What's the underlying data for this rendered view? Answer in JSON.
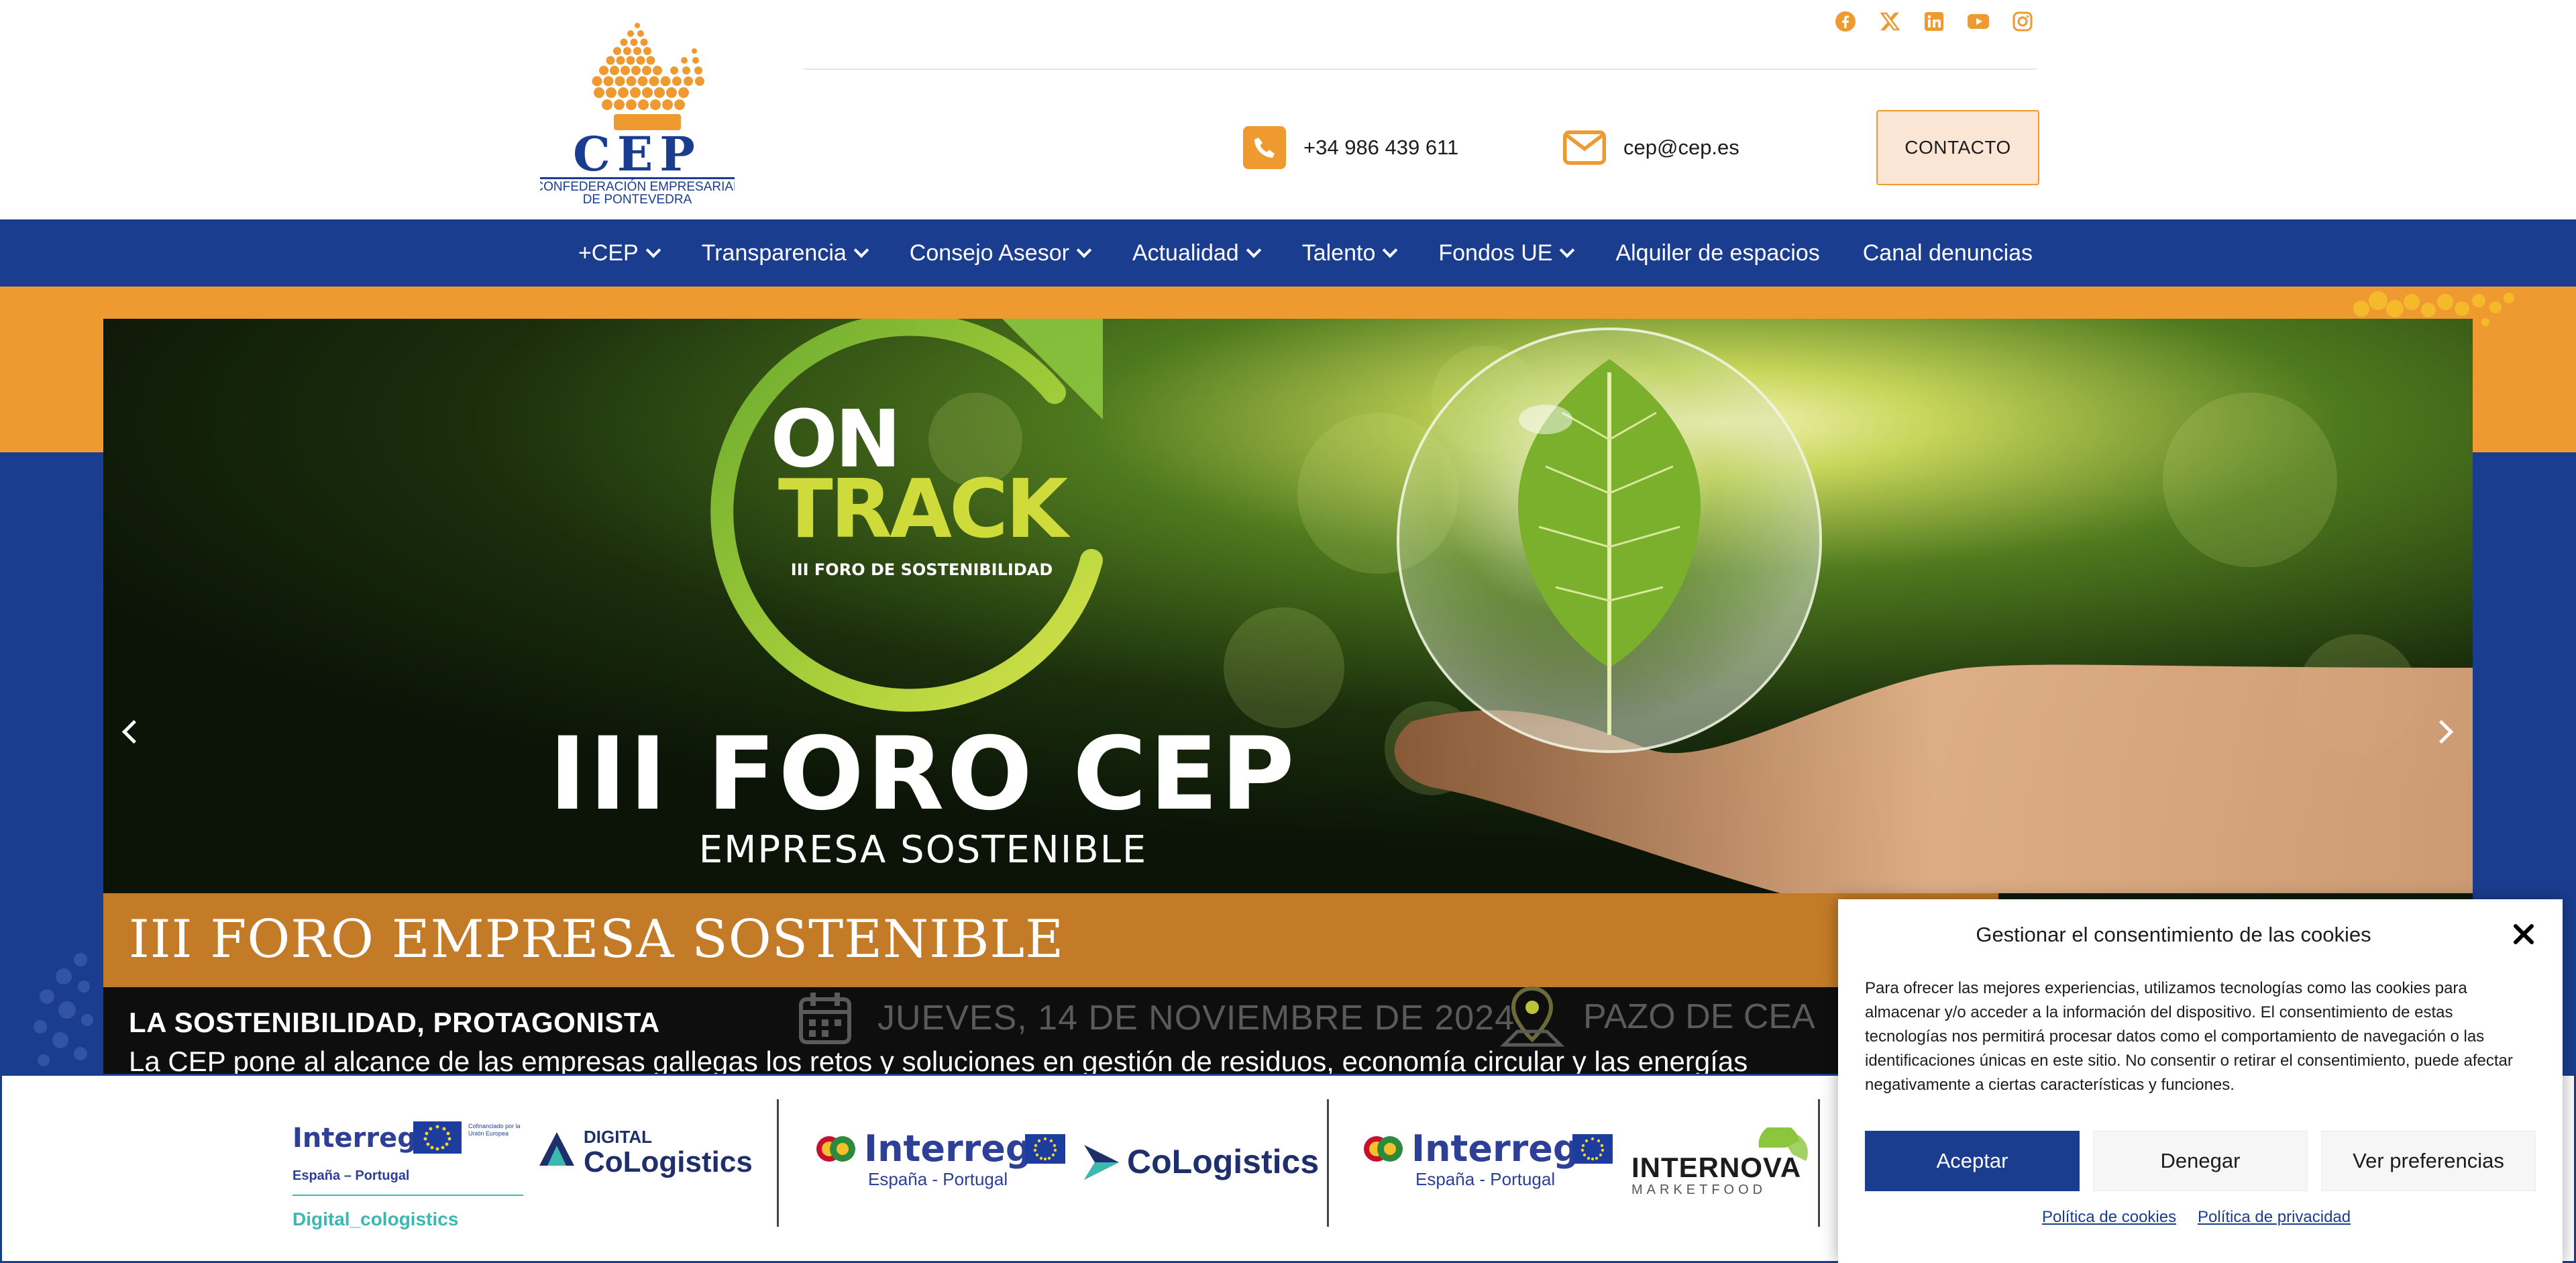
{
  "brand": {
    "logo_acronym": "CEP",
    "logo_subtitle_1": "CONFEDERACIÓN EMPRESARIAL",
    "logo_subtitle_2": "DE PONTEVEDRA",
    "colors": {
      "orange": "#ef9a31",
      "navy": "#1b3d8f",
      "caption_orange": "#c37b27"
    }
  },
  "social": [
    {
      "icon": "facebook-icon"
    },
    {
      "icon": "x-icon"
    },
    {
      "icon": "linkedin-icon"
    },
    {
      "icon": "youtube-icon"
    },
    {
      "icon": "instagram-icon"
    }
  ],
  "contact": {
    "phone": "+34 986 439 611",
    "phone_icon": "phone-icon",
    "email": "cep@cep.es",
    "email_icon": "envelope-icon",
    "button_label": "CONTACTO"
  },
  "nav": {
    "items": [
      {
        "label": "+CEP",
        "dropdown": true
      },
      {
        "label": "Transparencia",
        "dropdown": true
      },
      {
        "label": "Consejo Asesor",
        "dropdown": true
      },
      {
        "label": "Actualidad",
        "dropdown": true
      },
      {
        "label": "Talento",
        "dropdown": true
      },
      {
        "label": "Fondos UE",
        "dropdown": true
      },
      {
        "label": "Alquiler de espacios",
        "dropdown": false
      },
      {
        "label": "Canal denuncias",
        "dropdown": false
      }
    ]
  },
  "slide": {
    "badge_on": "ON",
    "badge_track": "TRACK",
    "badge_sub": "III FORO DE SOSTENIBILIDAD",
    "headline": "III FORO CEP",
    "subheadline": "EMPRESA SOSTENIBLE",
    "event_date": "JUEVES, 14 DE NOVIEMBRE DE 2024",
    "event_place": "PAZO DE CEA",
    "caption_title": "III FORO EMPRESA SOSTENIBLE",
    "caption_subtitle": "LA SOSTENIBILIDAD, PROTAGONISTA",
    "caption_text": "La CEP pone al alcance de las empresas gallegas los retos y soluciones en gestión de residuos, economía circular y las energías"
  },
  "sponsors": {
    "logo1": {
      "program": "Interreg",
      "region": "España – Portugal",
      "eu_note": "Cofinanciado por la Unión Europea",
      "partner_line1": "DIGITAL",
      "partner_line2": "CoLogistics",
      "caption": "Digital_cologistics"
    },
    "logo2": {
      "program": "Interreg",
      "region": "España - Portugal",
      "partner": "CoLogistics"
    },
    "logo3": {
      "program": "Interreg",
      "region": "España - Portugal",
      "partner_line1": "INTERNOVA",
      "partner_line2": "MARKETFOOD"
    }
  },
  "cookie": {
    "title": "Gestionar el consentimiento de las cookies",
    "body": "Para ofrecer las mejores experiencias, utilizamos tecnologías como las cookies para almacenar y/o acceder a la información del dispositivo. El consentimiento de estas tecnologías nos permitirá procesar datos como el comportamiento de navegación o las identificaciones únicas en este sitio. No consentir o retirar el consentimiento, puede afectar negativamente a ciertas características y funciones.",
    "accept": "Aceptar",
    "deny": "Denegar",
    "preferences": "Ver preferencias",
    "cookie_policy": "Política de cookies",
    "privacy_policy": "Política de privacidad"
  }
}
